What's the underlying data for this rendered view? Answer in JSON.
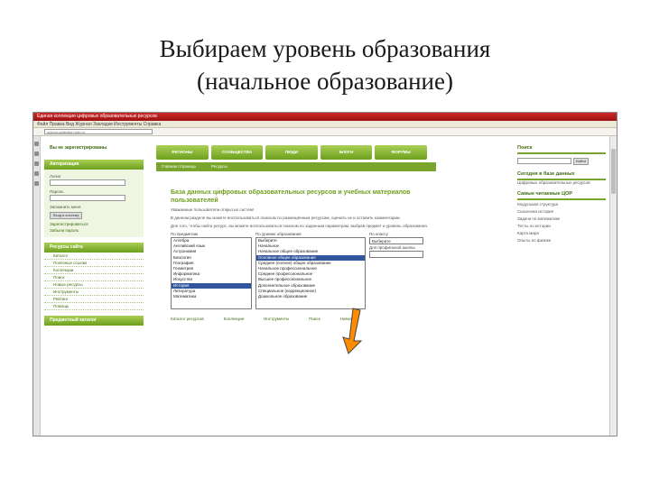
{
  "slide": {
    "title_line1": "Выбираем уровень образования",
    "title_line2": "(начальное образование)"
  },
  "browser": {
    "title": "Единая коллекция цифровых образовательных ресурсов",
    "menu": "Файл  Правка  Вид  Журнал  Закладки  Инструменты  Справка",
    "address": "school-collection.edu.ru"
  },
  "nav": {
    "items": [
      "РЕГИОНЫ",
      "СООБЩЕСТВА",
      "ЛЮДИ",
      "БЛОГИ",
      "ФОРУМЫ"
    ]
  },
  "subnav": {
    "items": [
      "Главная страница",
      "Ресурсы"
    ]
  },
  "left": {
    "register": "Вы не зарегистрированы",
    "auth_title": "Авторизация",
    "login_label": "Логин",
    "password_label": "Пароль",
    "remember": "Запомнить меня",
    "login_btn": "Вход в систему",
    "register_link": "Зарегистрироваться",
    "forgot_link": "Забыли пароль",
    "resources_title": "Ресурсы сайта",
    "resources": [
      "Каталог",
      "Полезные ссылки",
      "Коллекции",
      "Поиск",
      "Новые ресурсы",
      "Инструменты",
      "Рейтинг",
      "Помощь"
    ],
    "catalog_title": "Предметный каталог"
  },
  "center": {
    "title": "База данных цифровых образовательных ресурсов и учебных материалов пользователей",
    "para1": "Уважаемые пользователи открытых систем!",
    "para2": "В данном разделе вы можете воспользоваться поиском по размещённым ресурсам, оценить их и оставить комментарии.",
    "para3": "Для того, чтобы найти ресурс, вы можете воспользоваться поиском по заданным параметрам, выбрав предмет и уровень образования.",
    "col1_label": "По предметам",
    "col2_label": "По уровню образования",
    "col3_label": "По классу",
    "subjects": [
      "Алгебра",
      "Английский язык",
      "Астрономия",
      "Биология",
      "География",
      "Геометрия",
      "Информатика",
      "Искусство",
      "История",
      "Литература",
      "Математика"
    ],
    "subject_selected_index": 8,
    "levels": [
      "Выберите",
      "Начальное",
      "Начальное общее образование",
      "Основное общее образование",
      "Среднее (полное) общее образование",
      "Начальное профессиональное",
      "Среднее профессиональное",
      "Высшее профессиональное",
      "Дополнительное образование",
      "Специальное (коррекционное)",
      "Дошкольное образование"
    ],
    "level_selected_index": 3,
    "grade": "Выберите",
    "extra_label": "Для профильной школы",
    "footer": [
      "Каталог ресурсов",
      "Коллекции",
      "Инструменты",
      "Поиск",
      "Новое"
    ]
  },
  "right": {
    "search_title": "Поиск",
    "search_btn": "Найти",
    "today_title": "Сегодня в базе данных",
    "today_text": "Цифровых образовательных ресурсов",
    "popular_title": "Самые читаемые ЦОР",
    "popular": [
      "Модульная структура",
      "Сказочная история",
      "Задачи по математике",
      "Тесты по истории",
      "Карта мира",
      "Опыты по физике"
    ]
  },
  "colors": {
    "accent": "#7aa52c",
    "selection": "#31569e",
    "arrow": "#ff8c00"
  },
  "icons": [
    "arrow-down-icon"
  ]
}
